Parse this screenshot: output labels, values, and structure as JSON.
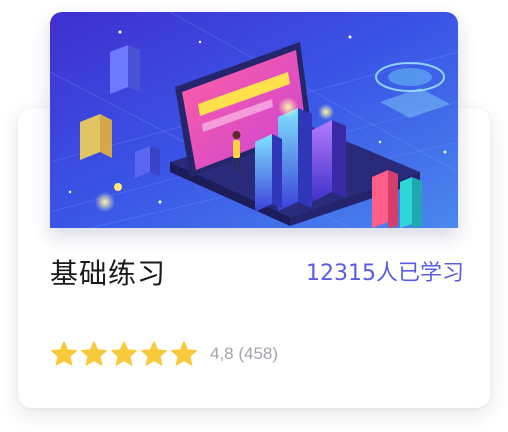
{
  "course": {
    "title": "基础练习",
    "learners": "12315人已学习",
    "rating_text": "4,8 (458)",
    "rating": 4.8,
    "rating_max": 5,
    "star_icon": "star-icon",
    "banner_image": "isometric-tech-illustration"
  },
  "colors": {
    "accent": "#5b5ce0",
    "star": "#f9c93c",
    "muted": "#a3a3ab",
    "title": "#1a1a1a"
  }
}
